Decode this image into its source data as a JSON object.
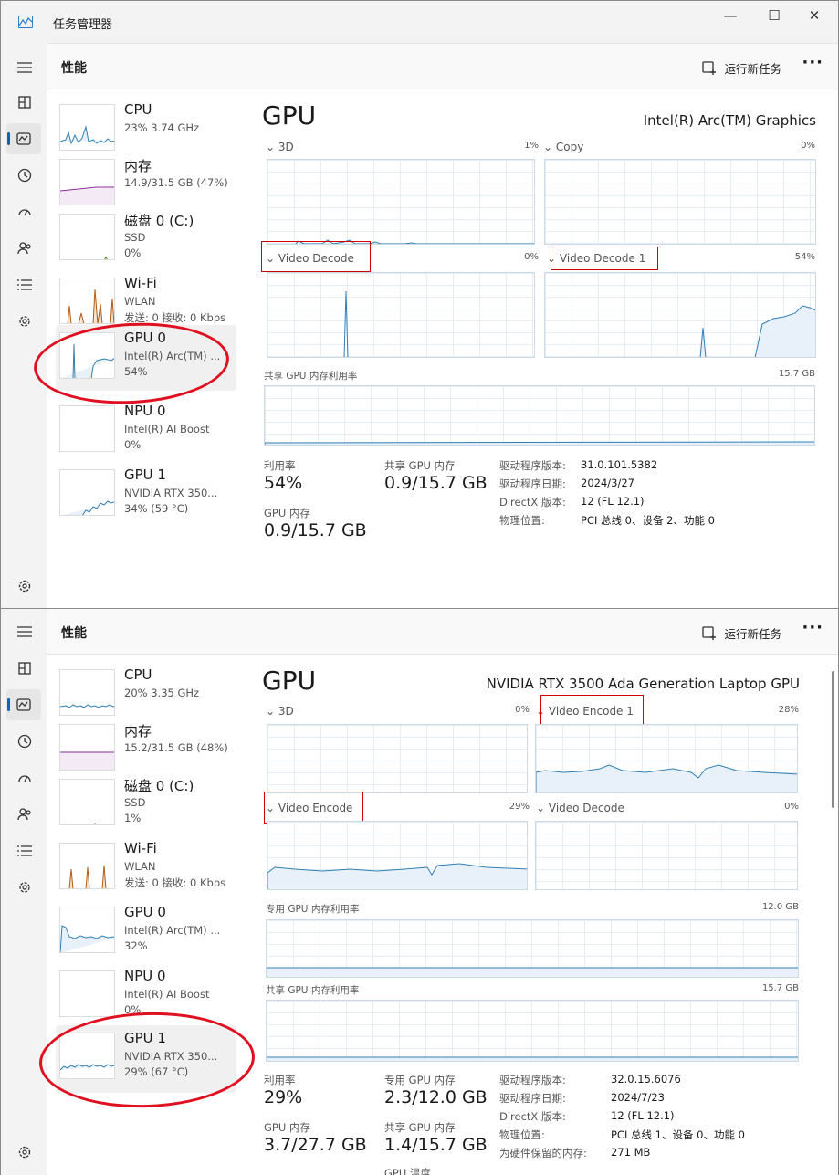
{
  "app": {
    "title": "任务管理器",
    "min": "—",
    "max": "☐",
    "close": "✕"
  },
  "rail_icons": [
    "menu-icon",
    "processes-icon",
    "performance-icon",
    "app-history-icon",
    "startup-icon",
    "users-icon",
    "details-icon",
    "services-icon"
  ],
  "header": {
    "title": "性能",
    "run_new_task": "运行新任务",
    "more": "···"
  },
  "accent": "#0067c0",
  "win1": {
    "devices": [
      {
        "name": "CPU",
        "l1": "23%  3.74 GHz",
        "l2": ""
      },
      {
        "name": "内存",
        "l1": "14.9/31.5 GB (47%)",
        "l2": ""
      },
      {
        "name": "磁盘 0 (C:)",
        "l1": "SSD",
        "l2": "0%"
      },
      {
        "name": "Wi-Fi",
        "l1": "WLAN",
        "l2": "发送: 0  接收: 0 Kbps"
      },
      {
        "name": "GPU 0",
        "l1": "Intel(R) Arc(TM) ...",
        "l2": "54%"
      },
      {
        "name": "NPU 0",
        "l1": "Intel(R) AI Boost",
        "l2": "0%"
      },
      {
        "name": "GPU 1",
        "l1": "NVIDIA RTX 350...",
        "l2": "34% (59 °C)"
      }
    ],
    "gpu_title": "GPU",
    "gpu_model": "Intel(R) Arc(TM) Graphics",
    "engines": [
      {
        "label": "3D",
        "pct": "1%"
      },
      {
        "label": "Copy",
        "pct": "0%"
      },
      {
        "label": "Video Decode",
        "pct": "0%"
      },
      {
        "label": "Video Decode 1",
        "pct": "54%"
      }
    ],
    "shared_mem_label": "共享 GPU 内存利用率",
    "shared_mem_max": "15.7 GB",
    "stats": {
      "util_label": "利用率",
      "util_value": "54%",
      "shared_label": "共享 GPU 内存",
      "shared_value": "0.9/15.7 GB",
      "gpumem_label": "GPU 内存",
      "gpumem_value": "0.9/15.7 GB"
    },
    "info": [
      {
        "k": "驱动程序版本:",
        "v": "31.0.101.5382"
      },
      {
        "k": "驱动程序日期:",
        "v": "2024/3/27"
      },
      {
        "k": "DirectX 版本:",
        "v": "12 (FL 12.1)"
      },
      {
        "k": "物理位置:",
        "v": "PCI 总线 0、设备 2、功能 0"
      }
    ]
  },
  "win2": {
    "devices": [
      {
        "name": "CPU",
        "l1": "20%  3.35 GHz",
        "l2": ""
      },
      {
        "name": "内存",
        "l1": "15.2/31.5 GB (48%)",
        "l2": ""
      },
      {
        "name": "磁盘 0 (C:)",
        "l1": "SSD",
        "l2": "1%"
      },
      {
        "name": "Wi-Fi",
        "l1": "WLAN",
        "l2": "发送: 0  接收: 0 Kbps"
      },
      {
        "name": "GPU 0",
        "l1": "Intel(R) Arc(TM) ...",
        "l2": "32%"
      },
      {
        "name": "NPU 0",
        "l1": "Intel(R) AI Boost",
        "l2": "0%"
      },
      {
        "name": "GPU 1",
        "l1": "NVIDIA RTX 350...",
        "l2": "29% (67 °C)"
      }
    ],
    "gpu_title": "GPU",
    "gpu_model": "NVIDIA RTX 3500 Ada Generation Laptop GPU",
    "engines": [
      {
        "label": "3D",
        "pct": "0%"
      },
      {
        "label": "Video Encode 1",
        "pct": "28%"
      },
      {
        "label": "Video Encode",
        "pct": "29%"
      },
      {
        "label": "Video Decode",
        "pct": "0%"
      }
    ],
    "dedicated_mem_label": "专用 GPU 内存利用率",
    "dedicated_mem_max": "12.0 GB",
    "shared_mem_label": "共享 GPU 内存利用率",
    "shared_mem_max": "15.7 GB",
    "stats": {
      "util_label": "利用率",
      "util_value": "29%",
      "dedicated_label": "专用 GPU 内存",
      "dedicated_value": "2.3/12.0 GB",
      "gpumem_label": "GPU 内存",
      "gpumem_value": "3.7/27.7 GB",
      "shared_label": "共享 GPU 内存",
      "shared_value": "1.4/15.7 GB",
      "temp_label": "GPU 温度"
    },
    "info": [
      {
        "k": "驱动程序版本:",
        "v": "32.0.15.6076"
      },
      {
        "k": "驱动程序日期:",
        "v": "2024/7/23"
      },
      {
        "k": "DirectX 版本:",
        "v": "12 (FL 12.1)"
      },
      {
        "k": "物理位置:",
        "v": "PCI 总线 1、设备 0、功能 0"
      },
      {
        "k": "为硬件保留的内存:",
        "v": "271 MB"
      }
    ]
  }
}
